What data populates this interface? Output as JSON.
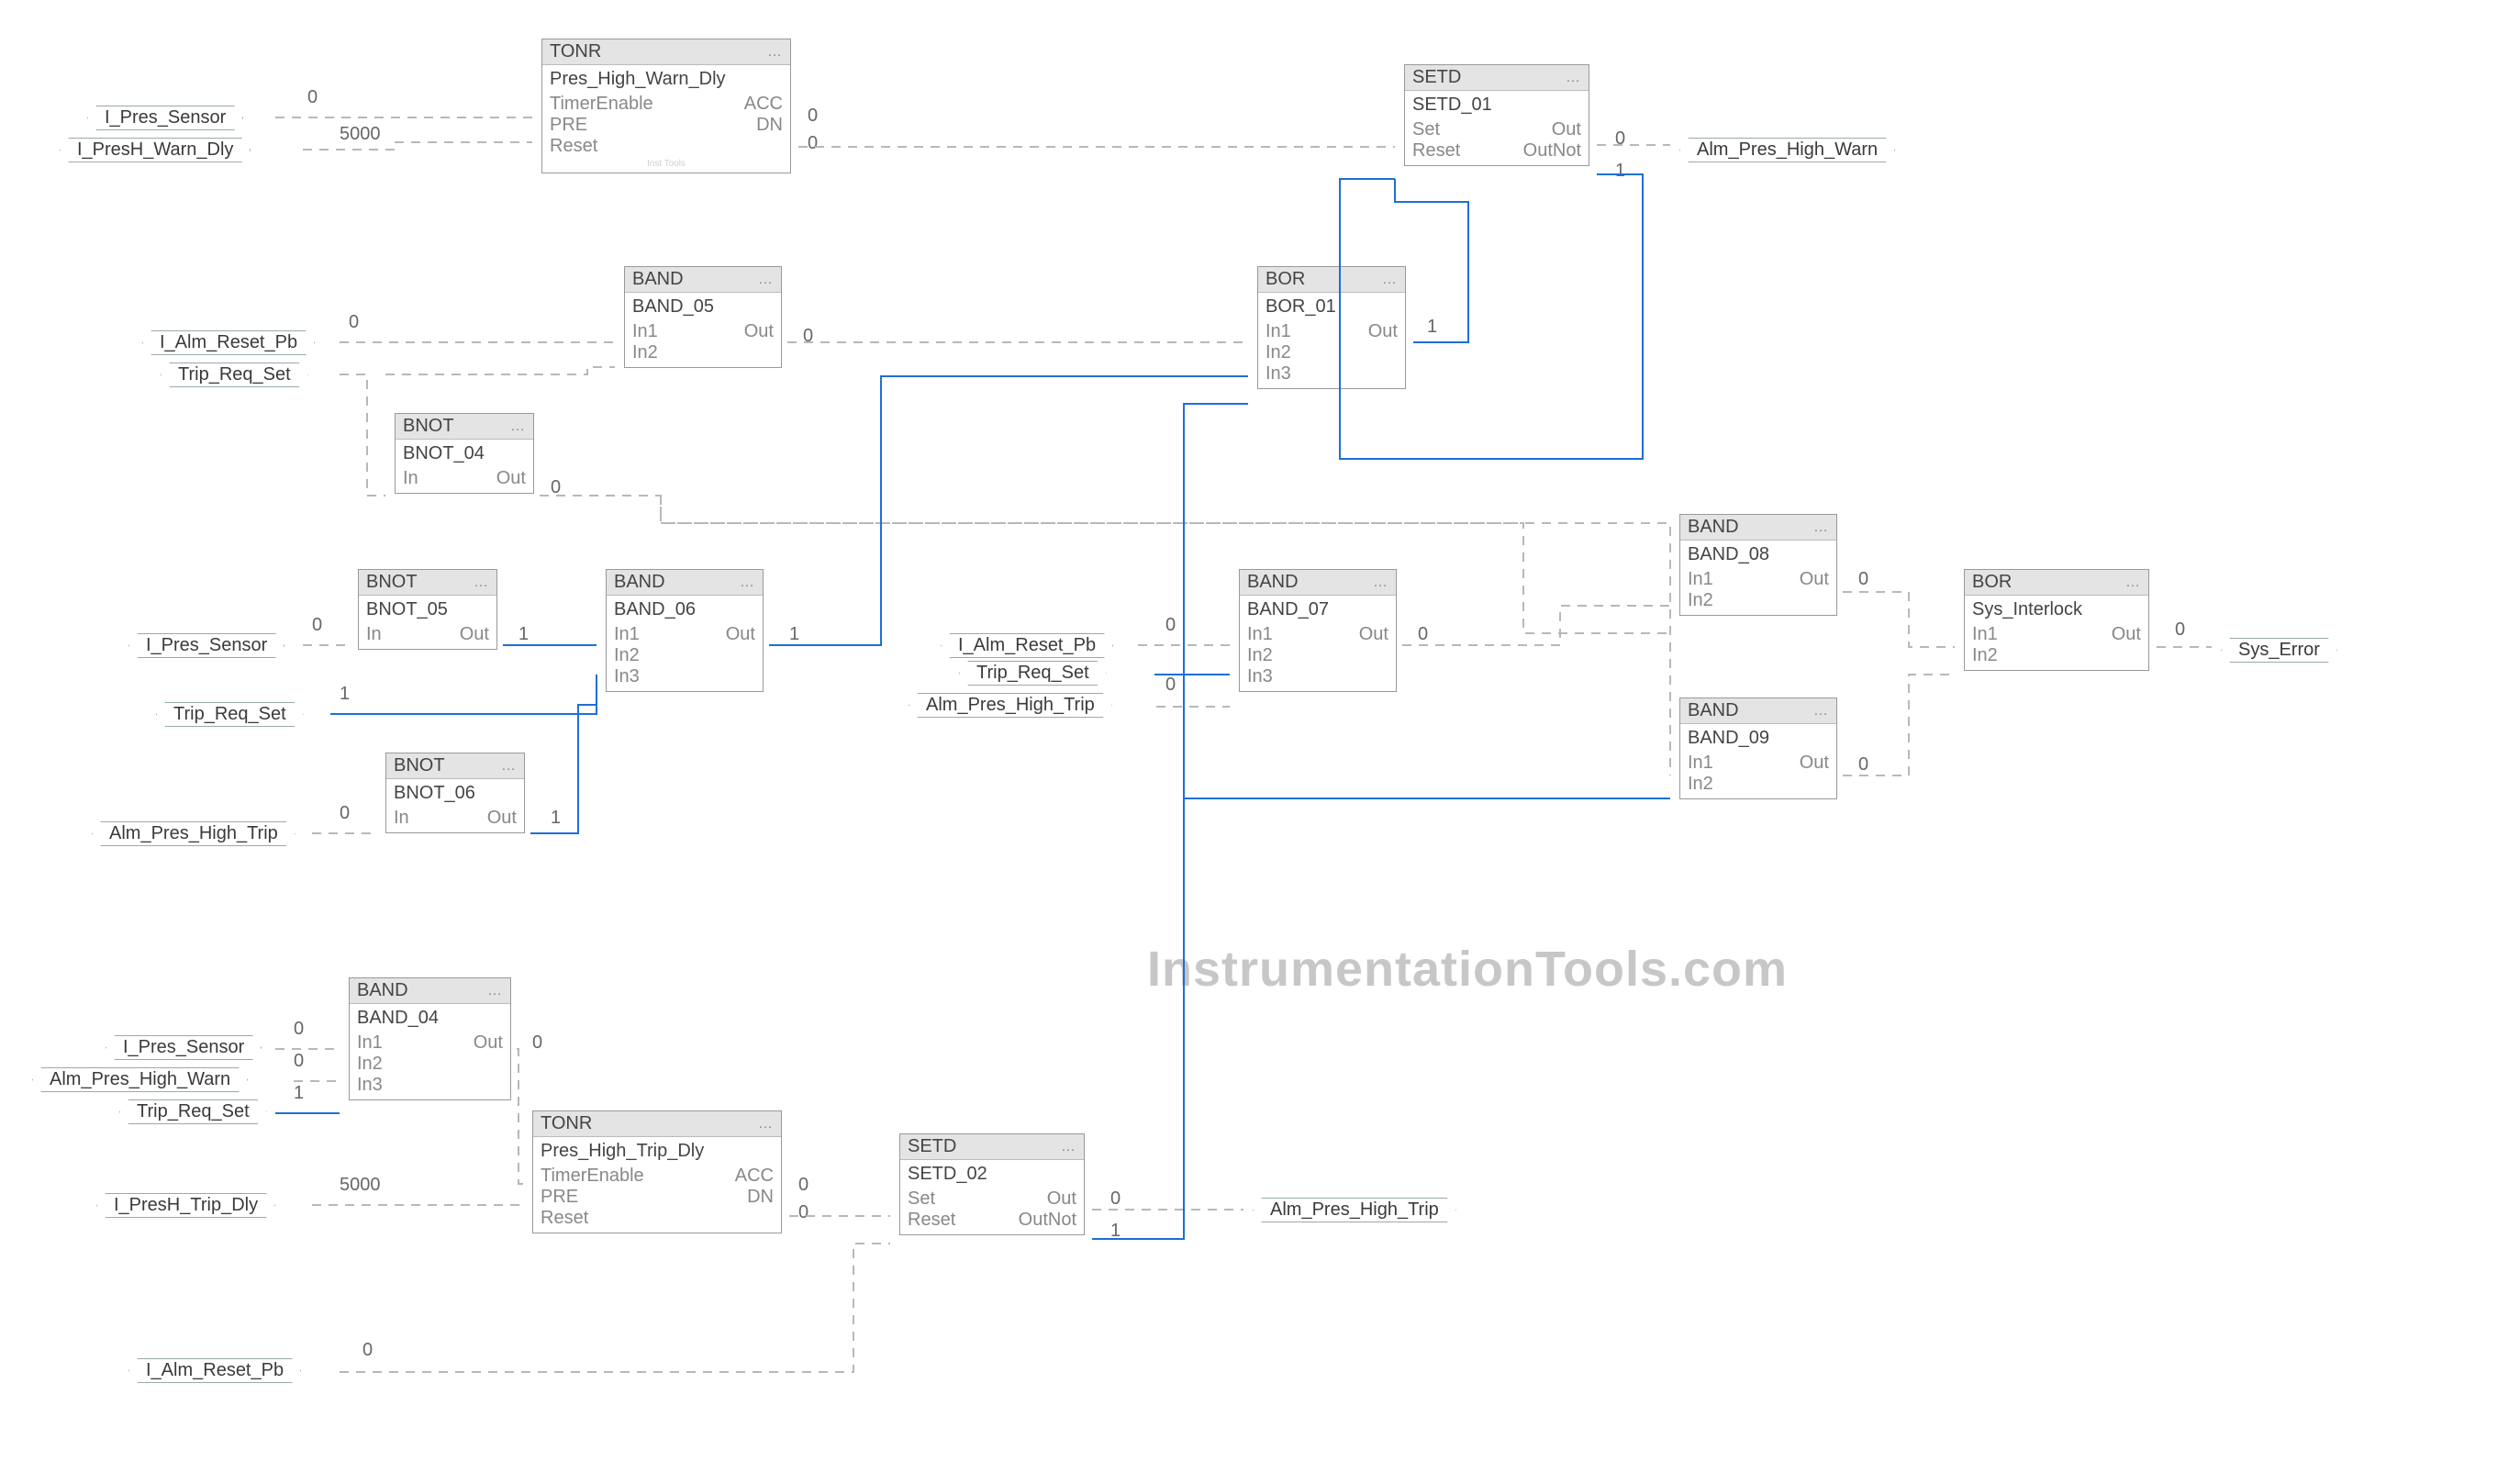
{
  "watermark": "InstrumentationTools.com",
  "blocks": {
    "tonr1": {
      "type": "TONR",
      "inst": "Pres_High_Warn_Dly",
      "rows": [
        [
          "TimerEnable",
          "ACC"
        ],
        [
          "PRE",
          "DN"
        ],
        [
          "Reset",
          ""
        ]
      ],
      "wm": "Inst Tools",
      "acc": "0",
      "dn": "0"
    },
    "setd1": {
      "type": "SETD",
      "inst": "SETD_01",
      "rows": [
        [
          "Set",
          "Out"
        ],
        [
          "Reset",
          "OutNot"
        ]
      ]
    },
    "band5": {
      "type": "BAND",
      "inst": "BAND_05",
      "rows": [
        [
          "In1",
          "Out"
        ],
        [
          "In2",
          ""
        ]
      ]
    },
    "bnot4": {
      "type": "BNOT",
      "inst": "BNOT_04",
      "rows": [
        [
          "In",
          "Out"
        ]
      ]
    },
    "bor1": {
      "type": "BOR",
      "inst": "BOR_01",
      "rows": [
        [
          "In1",
          "Out"
        ],
        [
          "In2",
          ""
        ],
        [
          "In3",
          ""
        ]
      ]
    },
    "band8": {
      "type": "BAND",
      "inst": "BAND_08",
      "rows": [
        [
          "In1",
          "Out"
        ],
        [
          "In2",
          ""
        ]
      ]
    },
    "bnot5": {
      "type": "BNOT",
      "inst": "BNOT_05",
      "rows": [
        [
          "In",
          "Out"
        ]
      ]
    },
    "band6": {
      "type": "BAND",
      "inst": "BAND_06",
      "rows": [
        [
          "In1",
          "Out"
        ],
        [
          "In2",
          ""
        ],
        [
          "In3",
          ""
        ]
      ]
    },
    "band7": {
      "type": "BAND",
      "inst": "BAND_07",
      "rows": [
        [
          "In1",
          "Out"
        ],
        [
          "In2",
          ""
        ],
        [
          "In3",
          ""
        ]
      ]
    },
    "band9": {
      "type": "BAND",
      "inst": "BAND_09",
      "rows": [
        [
          "In1",
          "Out"
        ],
        [
          "In2",
          ""
        ]
      ]
    },
    "borSys": {
      "type": "BOR",
      "inst": "Sys_Interlock",
      "rows": [
        [
          "In1",
          "Out"
        ],
        [
          "In2",
          ""
        ]
      ]
    },
    "bnot6": {
      "type": "BNOT",
      "inst": "BNOT_06",
      "rows": [
        [
          "In",
          "Out"
        ]
      ]
    },
    "band4": {
      "type": "BAND",
      "inst": "BAND_04",
      "rows": [
        [
          "In1",
          "Out"
        ],
        [
          "In2",
          ""
        ],
        [
          "In3",
          ""
        ]
      ]
    },
    "tonr2": {
      "type": "TONR",
      "inst": "Pres_High_Trip_Dly",
      "rows": [
        [
          "TimerEnable",
          "ACC"
        ],
        [
          "PRE",
          "DN"
        ],
        [
          "Reset",
          ""
        ]
      ],
      "acc": "0",
      "dn": "0"
    },
    "setd2": {
      "type": "SETD",
      "inst": "SETD_02",
      "rows": [
        [
          "Set",
          "Out"
        ],
        [
          "Reset",
          "OutNot"
        ]
      ]
    }
  },
  "tags": {
    "t1": "I_Pres_Sensor",
    "t2": "I_PresH_Warn_Dly",
    "t3": "Alm_Pres_High_Warn",
    "t4": "I_Alm_Reset_Pb",
    "t5": "Trip_Req_Set",
    "t6": "I_Pres_Sensor",
    "t7": "Trip_Req_Set",
    "t8": "Alm_Pres_High_Trip",
    "t9": "I_Alm_Reset_Pb",
    "t10": "Trip_Req_Set",
    "t11": "Alm_Pres_High_Trip",
    "t12": "Sys_Error",
    "t13": "I_Pres_Sensor",
    "t14": "Alm_Pres_High_Warn",
    "t15": "Trip_Req_Set",
    "t16": "I_PresH_Trip_Dly",
    "t17": "Alm_Pres_High_Trip",
    "t18": "I_Alm_Reset_Pb"
  },
  "vals": {
    "v1": "0",
    "v2": "5000",
    "v3": "0",
    "v4": "1",
    "v5": "0",
    "v6": "0",
    "v7": "0",
    "v8": "1",
    "v9": "0",
    "v10": "1",
    "v11": "1",
    "v12": "1",
    "v13": "0",
    "v14": "0",
    "v15": "0",
    "v16": "0",
    "v17": "0",
    "v18": "0",
    "v19": "1",
    "v20": "0",
    "v21": "0",
    "v22": "0",
    "v23": "1",
    "v24": "0",
    "v25": "5000",
    "v26": "0",
    "v27": "0",
    "v28": "0",
    "v29": "1",
    "v30": "0"
  }
}
